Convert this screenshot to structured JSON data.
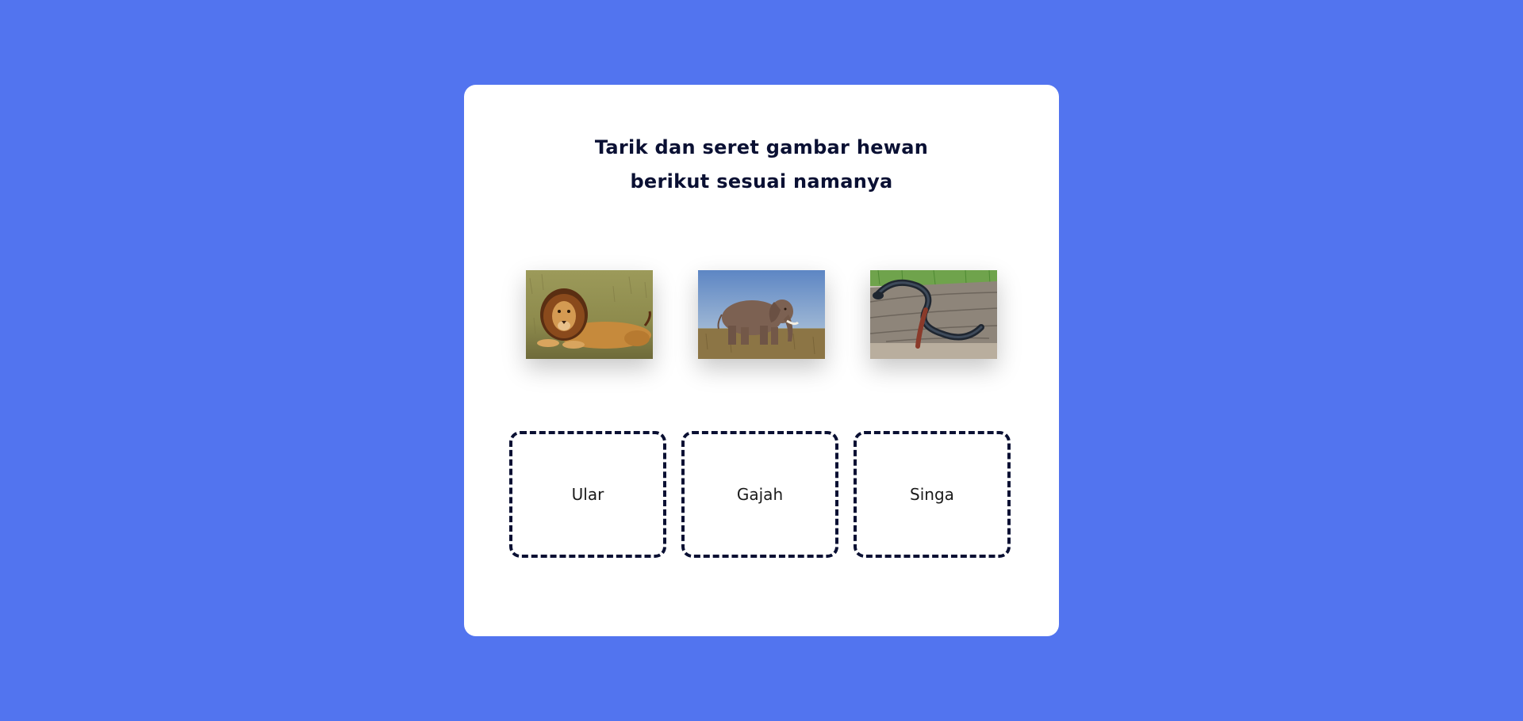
{
  "page": {
    "background_color": "#5274EF",
    "card_color": "#FFFFFF",
    "text_color": "#0A1033"
  },
  "instruction": {
    "line1": "Tarik dan seret gambar hewan",
    "line2": "berikut sesuai namanya"
  },
  "images": [
    {
      "name": "lion-image",
      "depicts": "lion"
    },
    {
      "name": "elephant-image",
      "depicts": "elephant"
    },
    {
      "name": "snake-image",
      "depicts": "snake"
    }
  ],
  "drop_zones": [
    {
      "label": "Ular"
    },
    {
      "label": "Gajah"
    },
    {
      "label": "Singa"
    }
  ]
}
